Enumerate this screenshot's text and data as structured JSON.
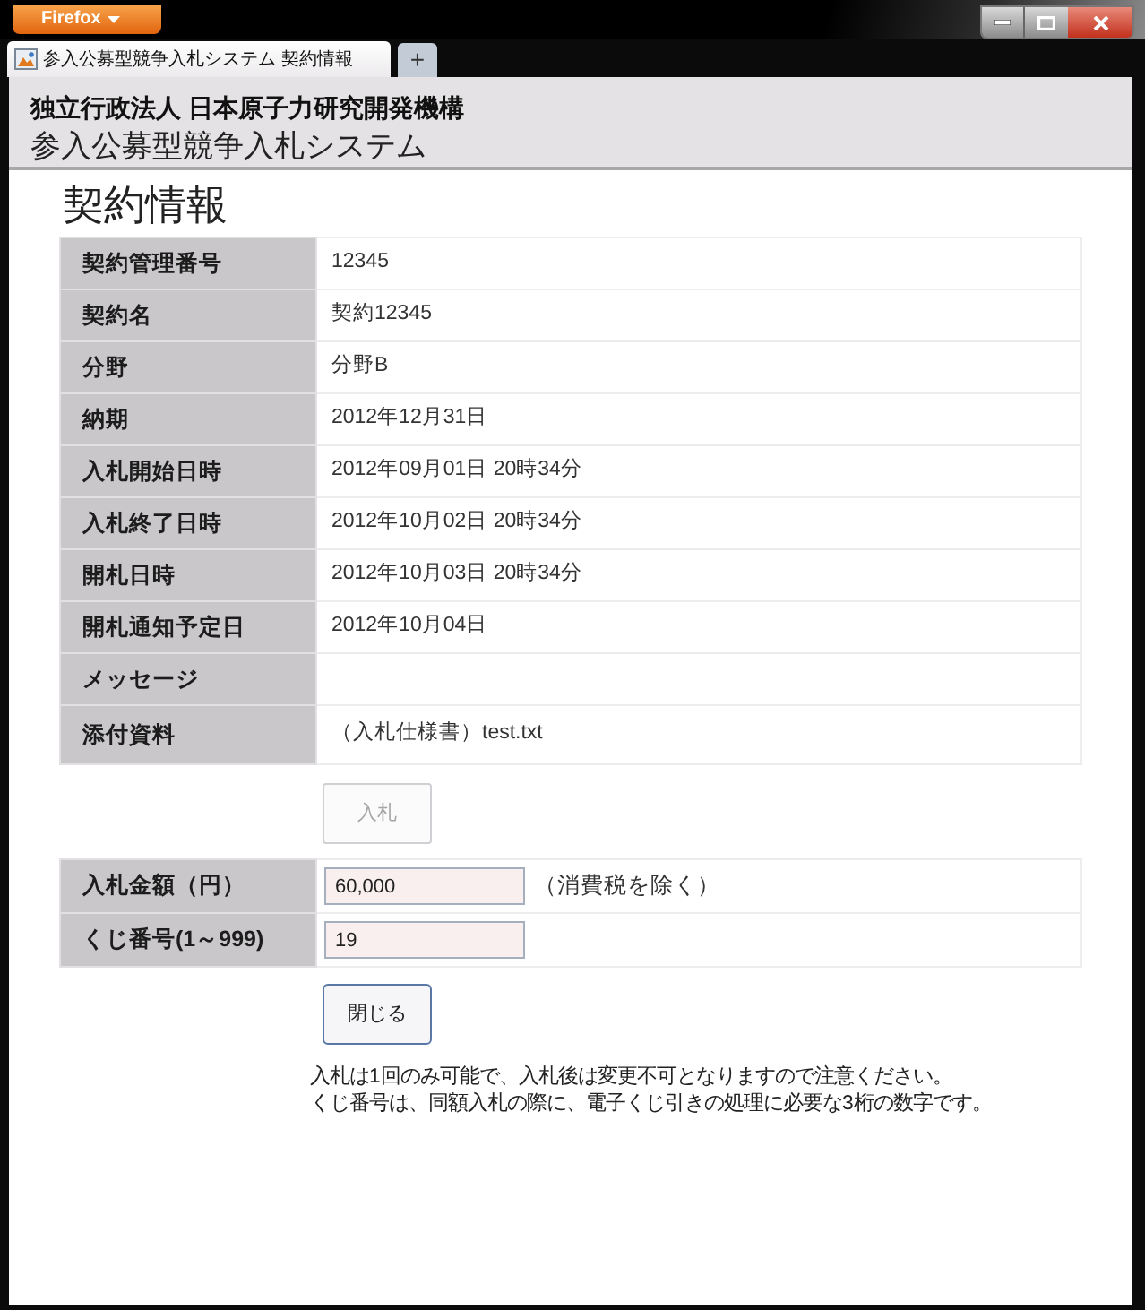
{
  "window": {
    "app_button": "Firefox",
    "tabs": [
      {
        "label": "参入公募型競争入札システム 契約情報",
        "selected": true
      }
    ],
    "new_tab": "+"
  },
  "header": {
    "organization": "独立行政法人 日本原子力研究開発機構",
    "system": "参入公募型競争入札システム"
  },
  "page_title": "契約情報",
  "details": [
    {
      "label": "契約管理番号",
      "value": "12345"
    },
    {
      "label": "契約名",
      "value": "契約12345"
    },
    {
      "label": "分野",
      "value": "分野B"
    },
    {
      "label": "納期",
      "value": "2012年12月31日"
    },
    {
      "label": "入札開始日時",
      "value": "2012年09月01日 20時34分"
    },
    {
      "label": "入札終了日時",
      "value": "2012年10月02日 20時34分"
    },
    {
      "label": "開札日時",
      "value": "2012年10月03日 20時34分"
    },
    {
      "label": "開札通知予定日",
      "value": "2012年10月04日"
    },
    {
      "label": "メッセージ"
    },
    {
      "label": "添付資料",
      "value": "（入札仕様書）test.txt"
    }
  ],
  "bid_button": {
    "label": "入札",
    "disabled": true
  },
  "bid_form": [
    {
      "label": "入札金額（円）",
      "value": "60,000",
      "note": "（消費税を除く）"
    },
    {
      "label": "くじ番号(1～999)",
      "value": "19"
    }
  ],
  "close_button": {
    "label": "閉じる"
  },
  "notes": [
    "入札は1回のみ可能で、入札後は変更不可となりますので注意ください。",
    "くじ番号は、同額入札の際に、電子くじ引きの処理に必要な3桁の数字です。"
  ]
}
